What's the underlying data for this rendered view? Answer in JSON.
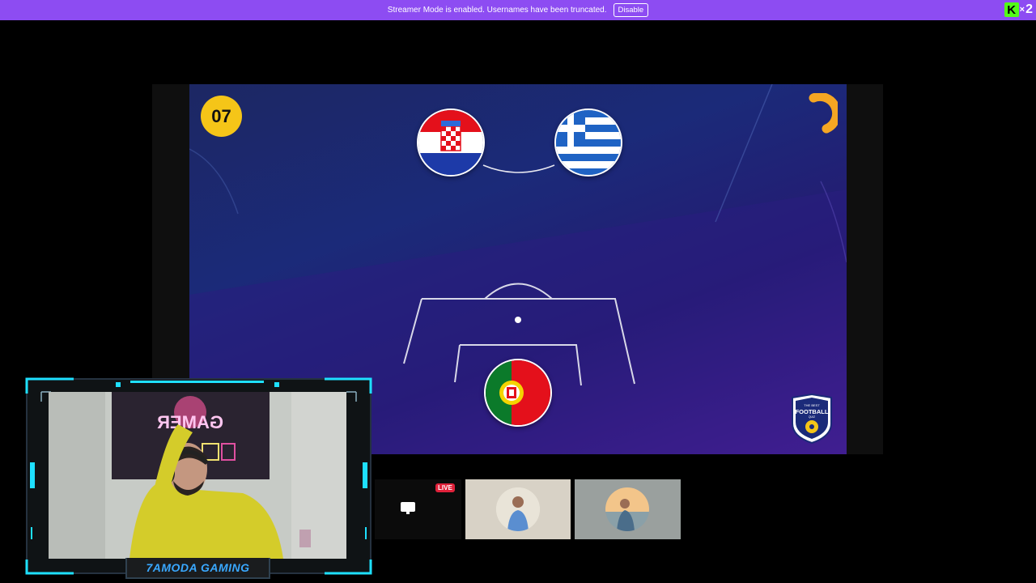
{
  "banner": {
    "message": "Streamer Mode is enabled. Usernames have been truncated.",
    "disable_label": "Disable"
  },
  "brand": {
    "k": "K",
    "x": "×",
    "two": "2"
  },
  "game": {
    "timer": "07",
    "teams_top": [
      "croatia-flag",
      "greece-flag"
    ],
    "team_bottom": "portugal-flag",
    "logo_line1": "THE BEST",
    "logo_line2": "FOOTBALL",
    "logo_line3": "QUIZ"
  },
  "webcam": {
    "streamer_name": "7AMODA GAMING",
    "neon_sign": "GAMER"
  },
  "participants": {
    "live_badge": "LIVE",
    "screen_icon": "monitor-icon"
  },
  "colors": {
    "banner": "#8d4cf2",
    "timer": "#f5c518",
    "frame_accent": "#1ee0ff",
    "live": "#e0213a"
  }
}
